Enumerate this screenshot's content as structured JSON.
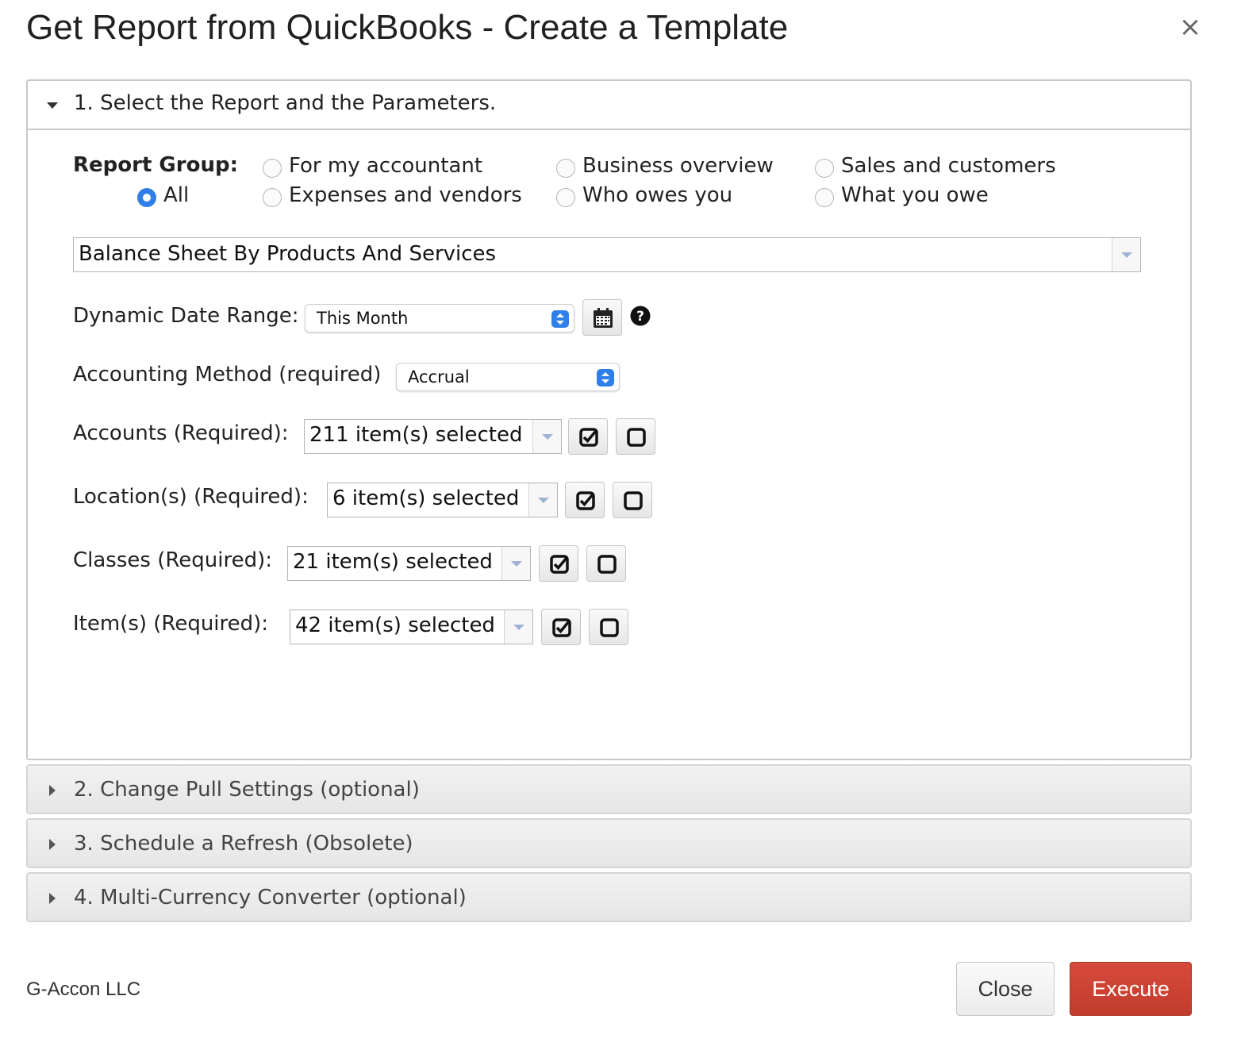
{
  "dialog": {
    "title": "Get Report from QuickBooks - Create a Template",
    "close_icon": "close-icon"
  },
  "section1": {
    "header": "1. Select the Report and the Parameters.",
    "report_group": {
      "label": "Report Group:",
      "options": [
        {
          "label": "All",
          "checked": true
        },
        {
          "label": "For my accountant",
          "checked": false
        },
        {
          "label": "Expenses and vendors",
          "checked": false
        },
        {
          "label": "Business overview",
          "checked": false
        },
        {
          "label": "Who owes you",
          "checked": false
        },
        {
          "label": "Sales and customers",
          "checked": false
        },
        {
          "label": "What you owe",
          "checked": false
        }
      ]
    },
    "report_select": {
      "value": "Balance Sheet By Products And Services"
    },
    "date_range": {
      "label": "Dynamic Date Range:",
      "value": "This Month"
    },
    "accounting_method": {
      "label": "Accounting Method (required)",
      "value": "Accrual"
    },
    "accounts": {
      "label": "Accounts (Required):",
      "value": "211 item(s) selected"
    },
    "locations": {
      "label": "Location(s) (Required):",
      "value": "6 item(s) selected"
    },
    "classes": {
      "label": "Classes (Required):",
      "value": "21 item(s) selected"
    },
    "items": {
      "label": "Item(s) (Required):",
      "value": "42 item(s) selected"
    }
  },
  "sections": [
    {
      "label": "2. Change Pull Settings (optional)"
    },
    {
      "label": "3. Schedule a Refresh (Obsolete)"
    },
    {
      "label": "4. Multi-Currency Converter (optional)"
    }
  ],
  "footer": {
    "company": "G-Accon LLC",
    "close_label": "Close",
    "execute_label": "Execute"
  },
  "colors": {
    "accent": "#2f7fe8",
    "execute": "#c9402f"
  }
}
